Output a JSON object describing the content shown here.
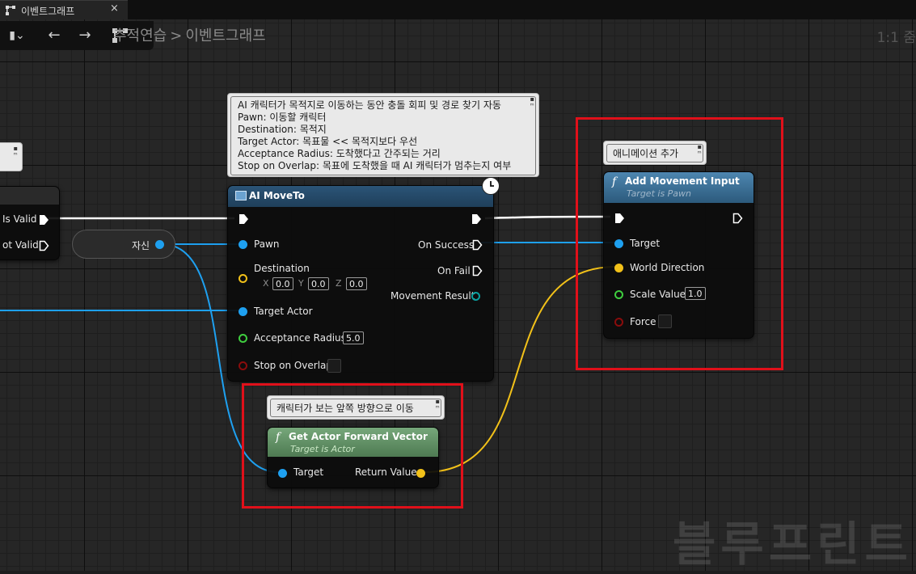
{
  "tab": {
    "label": "이벤트그래프",
    "close": "×"
  },
  "toolbar": {
    "back": "←",
    "forward": "→"
  },
  "breadcrumb": {
    "root": "추적연습",
    "separator": ">",
    "current": "이벤트그래프"
  },
  "zoom": "1:1 줌",
  "watermark": "블루프린트",
  "left_node": {
    "is_valid": "Is Valid",
    "not_valid": "ot Valid"
  },
  "self_var": {
    "label": "자신"
  },
  "ai_comment": {
    "lines": [
      "AI 캐릭터가 목적지로 이동하는 동안 충돌 회피 및 경로 찾기 자동",
      "Pawn: 이동할 캐릭터",
      "Destination: 목적지",
      "Target Actor: 목표물 << 목적지보다 우선",
      "Acceptance Radius: 도착했다고 간주되는 거리",
      "Stop on Overlap: 목표에 도착했을 때 AI 캐릭터가 멈추는지 여부"
    ]
  },
  "ai_moveto": {
    "title": "AI MoveTo",
    "pawn": "Pawn",
    "destination": "Destination",
    "dest_x_label": "X",
    "dest_x": "0.0",
    "dest_y_label": "Y",
    "dest_y": "0.0",
    "dest_z_label": "Z",
    "dest_z": "0.0",
    "target_actor": "Target Actor",
    "acceptance_radius": "Acceptance Radius",
    "acceptance_radius_value": "5.0",
    "stop_on_overlap": "Stop on Overlap",
    "on_success": "On Success",
    "on_fail": "On Fail",
    "movement_result": "Movement Result"
  },
  "anim_comment": {
    "text": "애니메이션 추가"
  },
  "add_movement": {
    "title": "Add Movement Input",
    "subtitle": "Target is Pawn",
    "target": "Target",
    "world_direction": "World Direction",
    "scale_value": "Scale Value",
    "scale_value_value": "1.0",
    "force": "Force"
  },
  "fwd_comment": {
    "text": "캐릭터가 보는 앞쪽 방향으로 이동"
  },
  "forward_vector": {
    "title": "Get Actor Forward Vector",
    "subtitle": "Target is Actor",
    "target": "Target",
    "return_value": "Return Value"
  },
  "colors": {
    "exec": "#ffffff",
    "object": "#1ea0f0",
    "vector": "#f2c119",
    "float": "#3fce3f",
    "bool": "#8a0c0c",
    "highlight": "#e0101a",
    "ai_header": "#1f3f5a",
    "func_header": "#3f6f92",
    "pure_header": "#4e7a52"
  }
}
